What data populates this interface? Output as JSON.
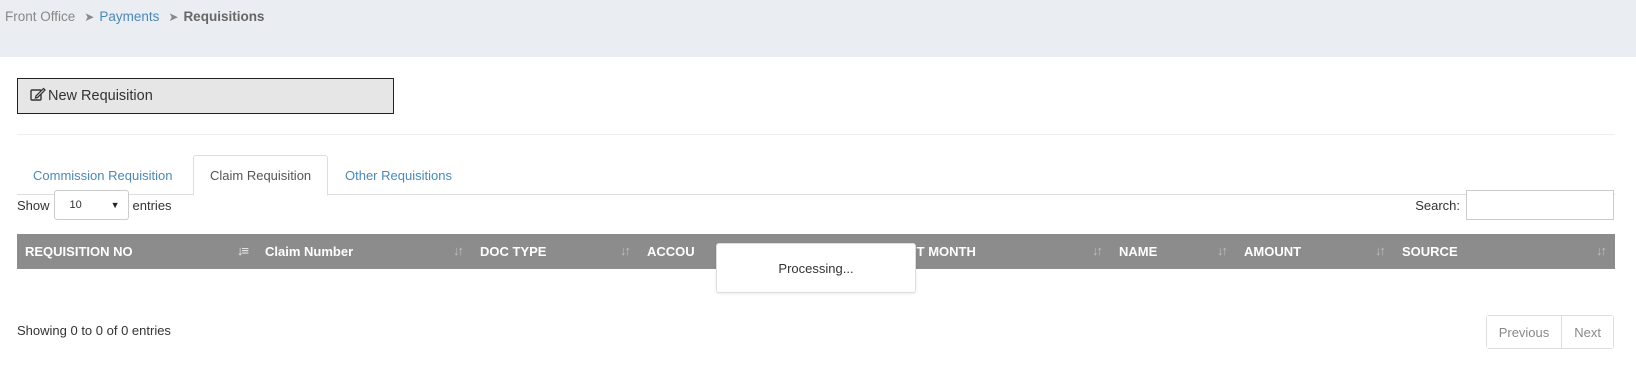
{
  "breadcrumb": {
    "home": "Front Office",
    "parent": "Payments",
    "current": "Requisitions"
  },
  "toolbar": {
    "new_label": "New Requisition",
    "new_icon": "edit-icon"
  },
  "tabs": [
    {
      "label": "Commission Requisition",
      "active": false
    },
    {
      "label": "Claim Requisition",
      "active": true
    },
    {
      "label": "Other Requisitions",
      "active": false
    }
  ],
  "length_menu": {
    "prefix": "Show",
    "value": "10",
    "suffix": "entries"
  },
  "search": {
    "label": "Search:",
    "value": ""
  },
  "table": {
    "columns": [
      {
        "label": "REQUISITION NO"
      },
      {
        "label": "Claim Number"
      },
      {
        "label": "DOC TYPE"
      },
      {
        "label": "ACCOU"
      },
      {
        "label": "CCOUNT MONTH"
      },
      {
        "label": "NAME"
      },
      {
        "label": "AMOUNT"
      },
      {
        "label": "SOURCE"
      }
    ],
    "processing": "Processing...",
    "info": "Showing 0 to 0 of 0 entries"
  },
  "pagination": {
    "previous": "Previous",
    "next": "Next"
  },
  "colors": {
    "topbar": "#eaedf1",
    "header": "#8c8c8c",
    "link": "#4a89b8"
  }
}
